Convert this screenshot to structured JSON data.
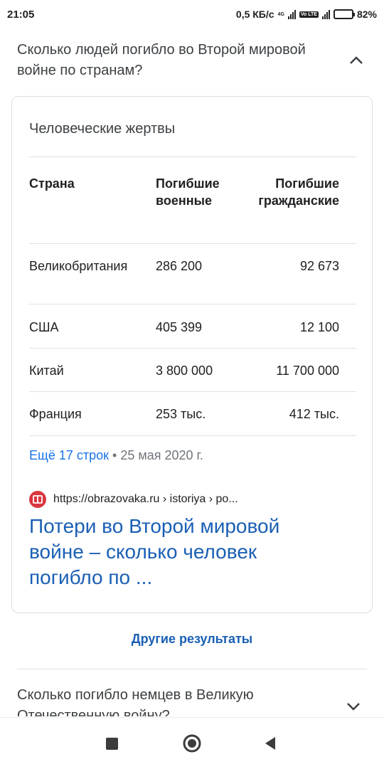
{
  "status_bar": {
    "time": "21:05",
    "speed": "0,5 КБ/с",
    "net_tag": "4G",
    "volte_tag": "Vo LTE",
    "battery": "82%",
    "battery_level": 82,
    "icons": [
      "signal-icon",
      "signal-icon",
      "battery-icon"
    ]
  },
  "question": {
    "text": "Сколько людей погибло во Второй мировой войне по странам?",
    "expanded": true
  },
  "card": {
    "title": "Человеческие жертвы",
    "table": {
      "headers": [
        "Страна",
        "Погибшие военные",
        "Погибшие гражданские"
      ],
      "rows": [
        [
          "Великобритания",
          "286 200",
          "92 673"
        ],
        [
          "США",
          "405 399",
          "12 100"
        ],
        [
          "Китай",
          "3 800 000",
          "11 700 000"
        ],
        [
          "Франция",
          "253 тыс.",
          "412 тыс."
        ]
      ]
    },
    "more_link": "Ещё 17 строк",
    "bullet": "•",
    "date": "25 мая 2020 г.",
    "source_url": "https://obrazovaka.ru › istoriya › po...",
    "result_title": "Потери во Второй мировой войне – сколько человек погибло по ..."
  },
  "other_results": "Другие результаты",
  "next_question": {
    "text": "Сколько погибло немцев в Великую Отечественную войну?"
  },
  "colors": {
    "link": "#1a5fb4",
    "accent": "#1a73e8",
    "favicon": "#d9363e",
    "battery": "#f5b800"
  }
}
